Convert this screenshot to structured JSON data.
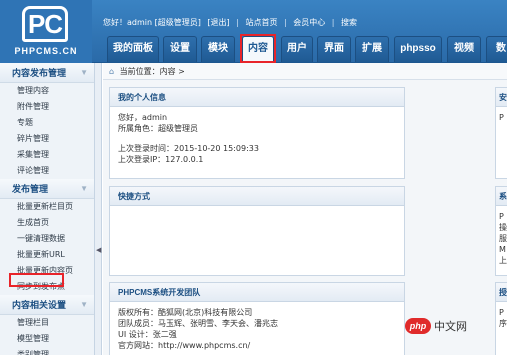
{
  "logo": {
    "mark": "PC",
    "text": "PHPCMS.CN"
  },
  "topbar": {
    "greeting": "您好！admin [超级管理员]",
    "logout": "[退出]",
    "site_home": "站点首页",
    "member_center": "会员中心",
    "search": "搜索"
  },
  "nav": {
    "tabs": [
      "我的面板",
      "设置",
      "模块",
      "内容",
      "用户",
      "界面",
      "扩展",
      "phpsso",
      "视频",
      "数"
    ],
    "active": "内容"
  },
  "sidebar": {
    "sections": [
      {
        "title": "内容发布管理",
        "items": [
          "管理内容",
          "附件管理",
          "专题",
          "碎片管理",
          "采集管理",
          "评论管理"
        ]
      },
      {
        "title": "发布管理",
        "items": [
          "批量更新栏目页",
          "生成首页",
          "一键清理数据",
          "批量更新URL",
          "批量更新内容页",
          "同步到发布点"
        ]
      },
      {
        "title": "内容相关设置",
        "items": [
          "管理栏目",
          "模型管理",
          "类别管理"
        ]
      }
    ]
  },
  "breadcrumb": {
    "label": "当前位置：内容 >"
  },
  "panels": {
    "my_info": {
      "title": "我的个人信息",
      "hello": "您好，admin",
      "role": "所属角色：超级管理员",
      "last_login_time": "上次登录时间：2015-10-20 15:09:33",
      "last_login_ip": "上次登录IP：127.0.0.1"
    },
    "shortcuts": {
      "title": "快捷方式"
    },
    "team": {
      "title": "PHPCMS系统开发团队",
      "owner": "版权所有：酷狐网(北京)科技有限公司",
      "members": "团队成员：马玉辉、张明雪、李天会、潘兆志",
      "ui": "UI 设计：张二强",
      "website": "官方网站：http://www.phpcms.cn/"
    },
    "right1": {
      "title": "安",
      "lines": [
        "P"
      ]
    },
    "right2": {
      "title": "系",
      "lines": [
        "P",
        "操",
        "服",
        "M",
        "上"
      ]
    },
    "right3": {
      "title": "授",
      "lines": [
        "P",
        "序"
      ]
    }
  },
  "watermark": {
    "logo": "php",
    "text": "中文网"
  }
}
